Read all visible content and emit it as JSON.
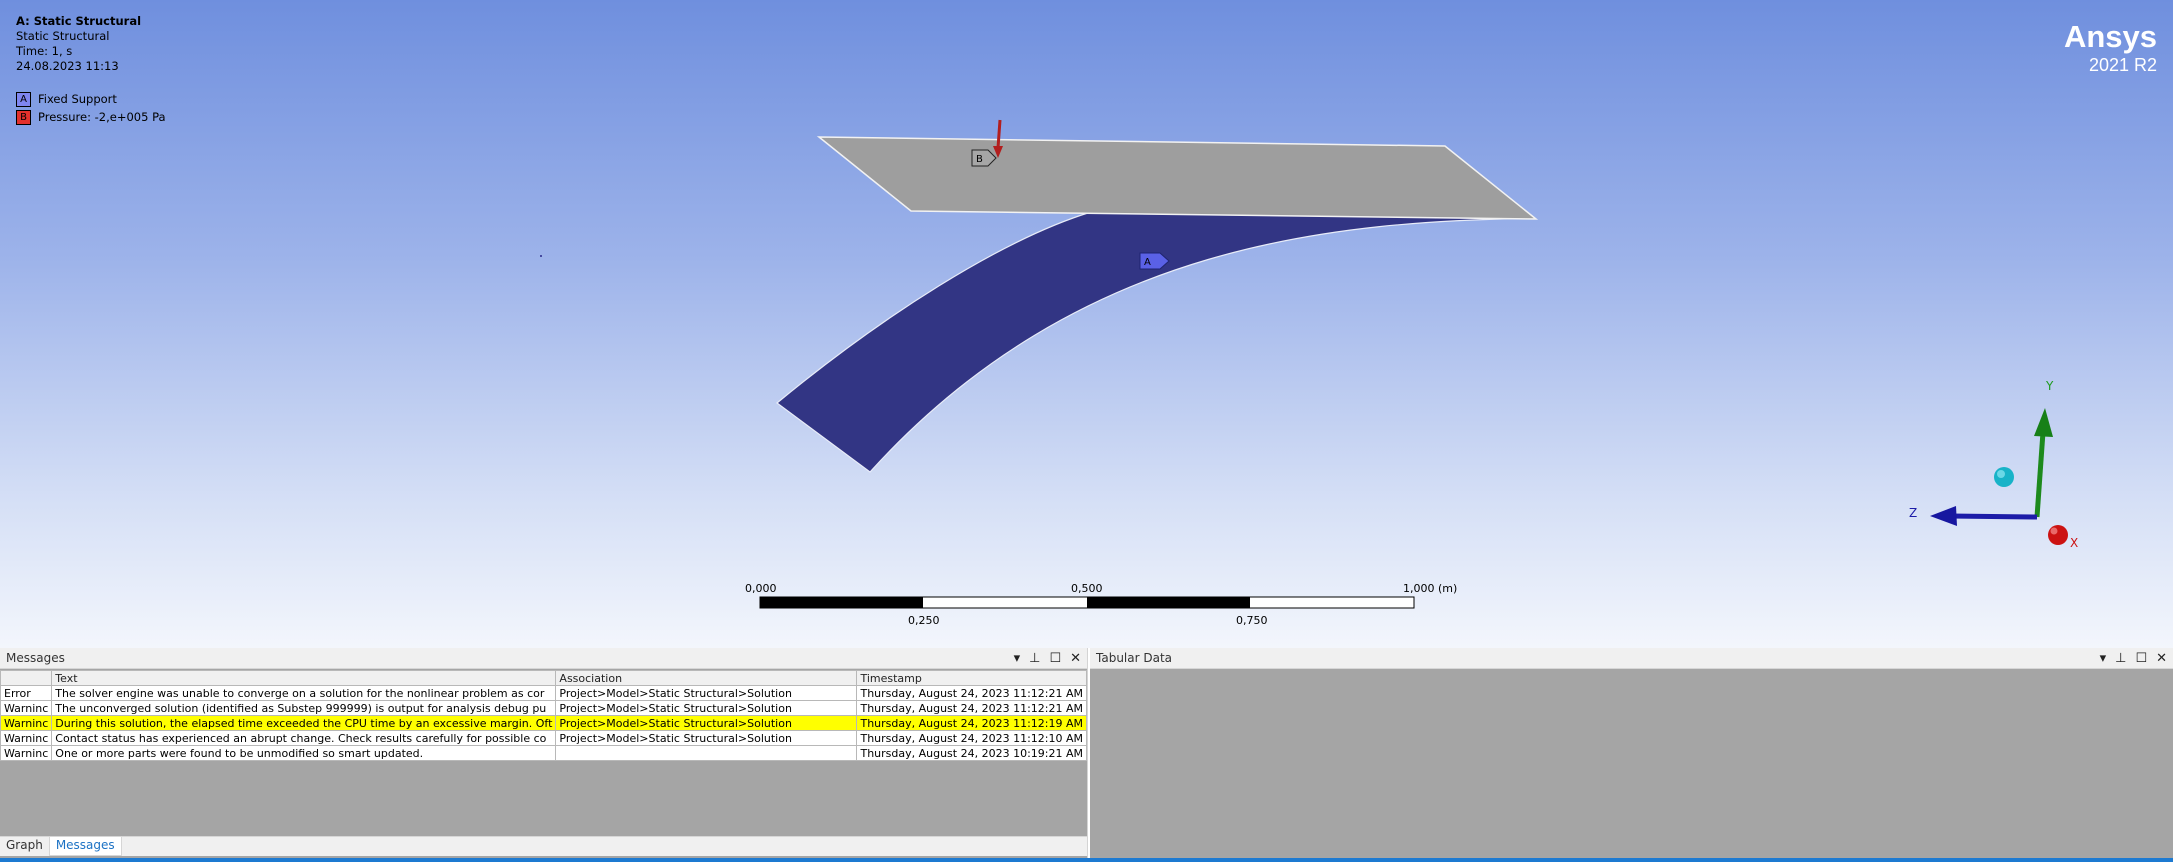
{
  "info": {
    "title": "A: Static Structural",
    "subtitle": "Static Structural",
    "time": "Time: 1, s",
    "date": "24.08.2023 11:13"
  },
  "legend": [
    {
      "key": "A",
      "label": "Fixed Support",
      "color": "#7f86f0"
    },
    {
      "key": "B",
      "label": "Pressure: -2,e+005 Pa",
      "color": "#e3312c"
    }
  ],
  "brand": {
    "name": "Ansys",
    "version": "2021 R2"
  },
  "scale": {
    "top_labels": [
      "0,000",
      "0,500",
      "1,000 (m)"
    ],
    "bottom_labels": [
      "0,250",
      "0,750"
    ]
  },
  "markers": {
    "a": "A",
    "b": "B"
  },
  "triad": {
    "x": "X",
    "y": "Y",
    "z": "Z"
  },
  "messages_pane": {
    "title": "Messages",
    "columns": [
      "",
      "Text",
      "Association",
      "Timestamp"
    ],
    "rows": [
      {
        "type": "Error",
        "text": "The solver engine was unable to converge on a solution for the nonlinear problem as cor",
        "association": "Project>Model>Static Structural>Solution",
        "timestamp": "Thursday, August 24, 2023 11:12:21 AM"
      },
      {
        "type": "Warninc",
        "text": "The unconverged solution (identified as Substep 999999) is output for analysis debug pu",
        "association": "Project>Model>Static Structural>Solution",
        "timestamp": "Thursday, August 24, 2023 11:12:21 AM"
      },
      {
        "type": "Warninc",
        "text": "During this solution, the elapsed time exceeded the CPU time by an excessive margin.  Oft",
        "association": "Project>Model>Static Structural>Solution",
        "timestamp": "Thursday, August 24, 2023 11:12:19 AM"
      },
      {
        "type": "Warninc",
        "text": "Contact status has experienced an abrupt change.  Check results carefully for possible co",
        "association": "Project>Model>Static Structural>Solution",
        "timestamp": "Thursday, August 24, 2023 11:12:10 AM"
      },
      {
        "type": "Warninc",
        "text": "One or more parts were found to be unmodified so smart updated.",
        "association": "",
        "timestamp": "Thursday, August 24, 2023 10:19:21 AM"
      }
    ]
  },
  "tabular_pane": {
    "title": "Tabular Data"
  },
  "bottom_tabs": [
    "Graph",
    "Messages"
  ],
  "controls": {
    "dropdown": "▾",
    "pin": "⊥",
    "maximize": "☐",
    "close": "✕"
  }
}
